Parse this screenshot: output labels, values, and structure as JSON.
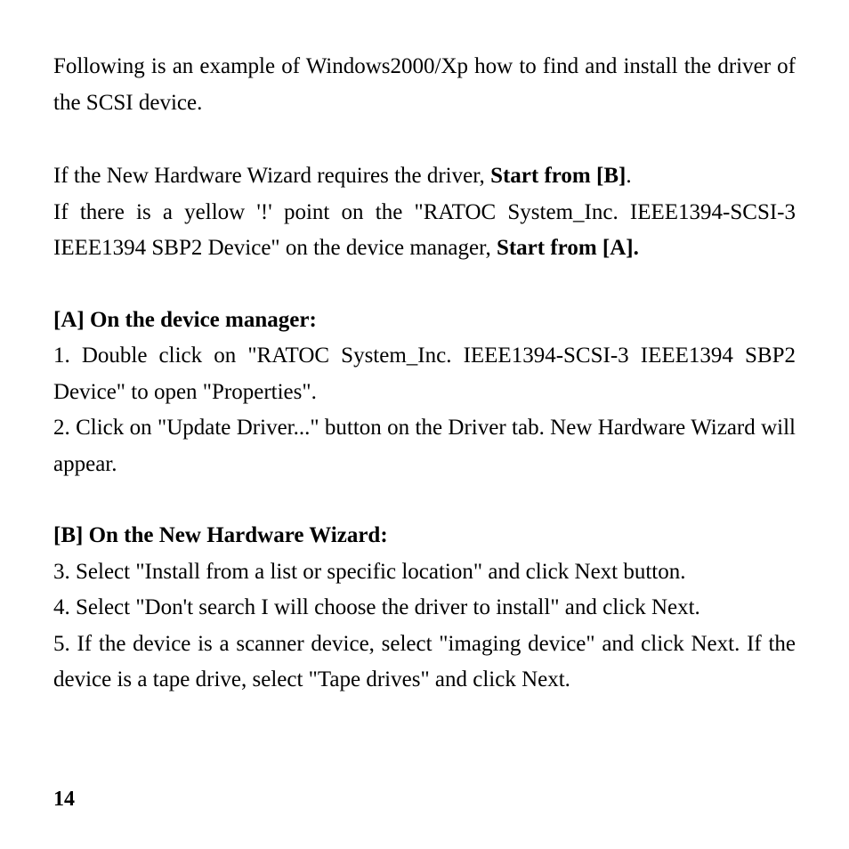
{
  "intro": "Following is an example of Windows2000/Xp how to find and install the driver of the SCSI device.",
  "cond_b_pre": "If the New Hardware Wizard requires the driver, ",
  "cond_b_bold": "Start from [B]",
  "cond_b_post": ".",
  "cond_a_pre": "If there is a yellow '!' point on the \"RATOC System_Inc. IEEE1394-SCSI-3 IEEE1394 SBP2 Device\" on the device manager, ",
  "cond_a_bold": "Start from [A].",
  "section_a_title": "[A] On the device manager:",
  "a1": "1. Double click on \"RATOC System_Inc. IEEE1394-SCSI-3 IEEE1394 SBP2 Device\" to open \"Properties\".",
  "a2": "2. Click on \"Update Driver...\" button on the Driver tab. New Hardware Wizard will appear.",
  "section_b_title": "[B] On the New Hardware Wizard:",
  "b3": "3. Select \"Install from a list or specific location\" and click Next button.",
  "b4": "4. Select \"Don't search I will choose the driver to install\" and click Next.",
  "b5": "5. If the device is a scanner device, select \"imaging device\" and click Next. If the device is a tape drive, select \"Tape drives\" and click Next.",
  "page_number": "14"
}
